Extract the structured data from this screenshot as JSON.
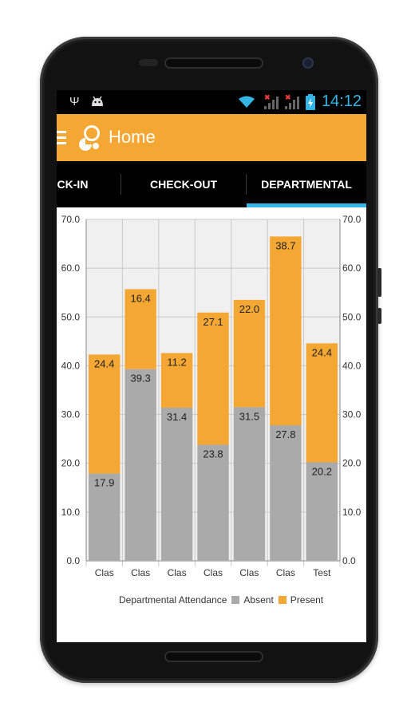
{
  "status_bar": {
    "time": "14:12",
    "icons": [
      "usb-icon",
      "android-icon",
      "wifi-icon",
      "signal-icon",
      "battery-icon"
    ]
  },
  "app_bar": {
    "title": "Home",
    "menu_icon": "hamburger-icon",
    "logo_icon": "app-logo-icon"
  },
  "tabs": [
    {
      "label": "CK-IN",
      "selected": false
    },
    {
      "label": "CHECK-OUT",
      "selected": false
    },
    {
      "label": "DEPARTMENTAL",
      "selected": true
    }
  ],
  "colors": {
    "accent": "#f5a733",
    "tab_indicator": "#33b5e5",
    "absent": "#aaaaaa",
    "present": "#f5a733"
  },
  "chart_data": {
    "type": "bar",
    "stacked": true,
    "categories": [
      "Clas",
      "Clas",
      "Clas",
      "Clas",
      "Clas",
      "Clas",
      "Test"
    ],
    "series": [
      {
        "name": "Absent",
        "values": [
          17.9,
          39.3,
          31.4,
          23.8,
          31.5,
          27.8,
          20.2
        ]
      },
      {
        "name": "Present",
        "values": [
          24.4,
          16.4,
          11.2,
          27.1,
          22.0,
          38.7,
          24.4
        ]
      }
    ],
    "y_ticks": [
      "0.0",
      "10.0",
      "20.0",
      "30.0",
      "40.0",
      "50.0",
      "60.0",
      "70.0"
    ],
    "ylim": [
      0,
      70
    ],
    "legend_title": "Departmental Attendance",
    "legend_position": "bottom-right",
    "grid": true
  }
}
